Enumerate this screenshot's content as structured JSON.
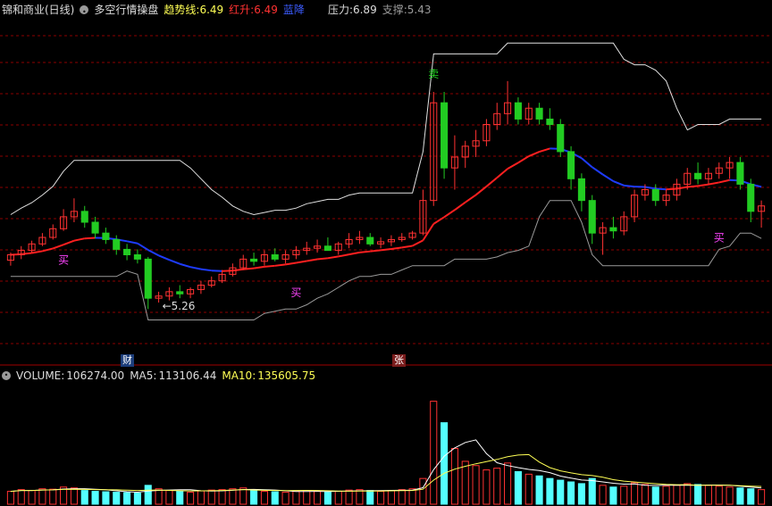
{
  "header": {
    "stock": "锦和商业(日线)",
    "indicator": "多空行情操盘",
    "trend_label": "趋势线:",
    "trend_value": "6.49",
    "red_label": "红升:",
    "red_value": "6.49",
    "blue_label": "蓝降",
    "pressure_label": "压力:",
    "pressure_value": "6.89",
    "support_label": "支撑:",
    "support_value": "5.43"
  },
  "volume_header": {
    "vol_label": "VOLUME:",
    "vol_value": "106274.00",
    "ma5_label": "MA5:",
    "ma5_value": "113106.44",
    "ma10_label": "MA10:",
    "ma10_value": "135605.75"
  },
  "annotations": {
    "buy": "买",
    "sell": "卖",
    "low_mark": "5.26",
    "badge_cai": "财",
    "badge_zhang": "张"
  },
  "colors": {
    "up": "#ff3232",
    "down": "#54ffff",
    "green": "#22cc22",
    "trend_red": "#ff2020",
    "trend_blue": "#1e3cff",
    "yellow": "#ffff55",
    "white": "#ffffff",
    "gray": "#9a9a9a",
    "magenta": "#ff44ff",
    "grid": "#8b0000"
  },
  "chart_data": {
    "type": "candlestick",
    "price_range": [
      4.8,
      7.8
    ],
    "candles": [
      [
        5.65,
        5.72,
        5.6,
        5.7
      ],
      [
        5.7,
        5.78,
        5.66,
        5.74
      ],
      [
        5.74,
        5.83,
        5.72,
        5.8
      ],
      [
        5.8,
        5.9,
        5.78,
        5.86
      ],
      [
        5.86,
        5.98,
        5.84,
        5.94
      ],
      [
        5.94,
        6.12,
        5.92,
        6.05
      ],
      [
        6.05,
        6.22,
        6.0,
        6.1
      ],
      [
        6.1,
        6.15,
        5.95,
        6.0
      ],
      [
        6.0,
        6.05,
        5.85,
        5.9
      ],
      [
        5.9,
        5.95,
        5.8,
        5.84
      ],
      [
        5.84,
        5.88,
        5.7,
        5.75
      ],
      [
        5.75,
        5.8,
        5.65,
        5.7
      ],
      [
        5.7,
        5.75,
        5.62,
        5.66
      ],
      [
        5.66,
        5.68,
        5.2,
        5.3
      ],
      [
        5.3,
        5.36,
        5.26,
        5.32
      ],
      [
        5.32,
        5.4,
        5.28,
        5.36
      ],
      [
        5.36,
        5.42,
        5.3,
        5.34
      ],
      [
        5.34,
        5.4,
        5.3,
        5.38
      ],
      [
        5.38,
        5.46,
        5.34,
        5.42
      ],
      [
        5.42,
        5.5,
        5.4,
        5.46
      ],
      [
        5.46,
        5.56,
        5.44,
        5.52
      ],
      [
        5.52,
        5.62,
        5.5,
        5.58
      ],
      [
        5.58,
        5.7,
        5.56,
        5.66
      ],
      [
        5.66,
        5.72,
        5.6,
        5.64
      ],
      [
        5.64,
        5.74,
        5.6,
        5.7
      ],
      [
        5.7,
        5.76,
        5.64,
        5.66
      ],
      [
        5.66,
        5.74,
        5.62,
        5.7
      ],
      [
        5.7,
        5.78,
        5.66,
        5.74
      ],
      [
        5.74,
        5.82,
        5.7,
        5.76
      ],
      [
        5.76,
        5.84,
        5.72,
        5.78
      ],
      [
        5.78,
        5.86,
        5.74,
        5.74
      ],
      [
        5.74,
        5.82,
        5.7,
        5.8
      ],
      [
        5.8,
        5.9,
        5.76,
        5.84
      ],
      [
        5.84,
        5.92,
        5.8,
        5.86
      ],
      [
        5.86,
        5.9,
        5.78,
        5.8
      ],
      [
        5.8,
        5.86,
        5.76,
        5.82
      ],
      [
        5.82,
        5.88,
        5.78,
        5.84
      ],
      [
        5.84,
        5.9,
        5.82,
        5.86
      ],
      [
        5.86,
        5.92,
        5.84,
        5.9
      ],
      [
        5.9,
        6.3,
        5.88,
        6.2
      ],
      [
        6.2,
        7.2,
        6.15,
        7.1
      ],
      [
        7.1,
        7.2,
        6.4,
        6.5
      ],
      [
        6.5,
        6.8,
        6.3,
        6.6
      ],
      [
        6.6,
        6.75,
        6.5,
        6.7
      ],
      [
        6.7,
        6.85,
        6.6,
        6.75
      ],
      [
        6.75,
        6.95,
        6.7,
        6.9
      ],
      [
        6.9,
        7.1,
        6.85,
        7.0
      ],
      [
        7.0,
        7.3,
        6.9,
        7.1
      ],
      [
        7.1,
        7.15,
        6.9,
        6.95
      ],
      [
        6.95,
        7.1,
        6.9,
        7.05
      ],
      [
        7.05,
        7.1,
        6.9,
        6.95
      ],
      [
        6.95,
        7.05,
        6.85,
        6.9
      ],
      [
        6.9,
        6.95,
        6.6,
        6.65
      ],
      [
        6.65,
        6.7,
        6.3,
        6.4
      ],
      [
        6.4,
        6.45,
        6.1,
        6.2
      ],
      [
        6.2,
        6.25,
        5.8,
        5.9
      ],
      [
        5.9,
        6.0,
        5.7,
        5.95
      ],
      [
        5.95,
        6.05,
        5.85,
        5.92
      ],
      [
        5.92,
        6.1,
        5.88,
        6.05
      ],
      [
        6.05,
        6.3,
        6.0,
        6.25
      ],
      [
        6.25,
        6.35,
        6.2,
        6.3
      ],
      [
        6.3,
        6.35,
        6.15,
        6.2
      ],
      [
        6.2,
        6.3,
        6.15,
        6.25
      ],
      [
        6.25,
        6.4,
        6.2,
        6.35
      ],
      [
        6.35,
        6.5,
        6.3,
        6.45
      ],
      [
        6.45,
        6.55,
        6.35,
        6.4
      ],
      [
        6.4,
        6.5,
        6.35,
        6.45
      ],
      [
        6.45,
        6.55,
        6.4,
        6.5
      ],
      [
        6.5,
        6.6,
        6.4,
        6.55
      ],
      [
        6.55,
        6.6,
        6.3,
        6.35
      ],
      [
        6.35,
        6.4,
        6.0,
        6.1
      ],
      [
        6.1,
        6.2,
        5.95,
        6.15
      ]
    ],
    "volume_range": [
      0,
      130000
    ],
    "volumes": [
      15000,
      17000,
      16000,
      18000,
      17500,
      20000,
      19000,
      16000,
      15000,
      14500,
      14000,
      13500,
      13000,
      22000,
      18000,
      16000,
      15000,
      14000,
      15500,
      16500,
      17000,
      18000,
      19000,
      16000,
      15000,
      14500,
      14000,
      15000,
      16000,
      15500,
      14000,
      15000,
      16500,
      17000,
      16000,
      15000,
      16000,
      17000,
      18000,
      30000,
      120000,
      95000,
      65000,
      50000,
      45000,
      40000,
      42000,
      48000,
      38000,
      35000,
      33000,
      30000,
      28000,
      26000,
      24000,
      30000,
      22000,
      20000,
      21000,
      25000,
      23000,
      20000,
      21000,
      22000,
      24000,
      23000,
      22000,
      21000,
      20000,
      19000,
      18000,
      17000
    ]
  }
}
